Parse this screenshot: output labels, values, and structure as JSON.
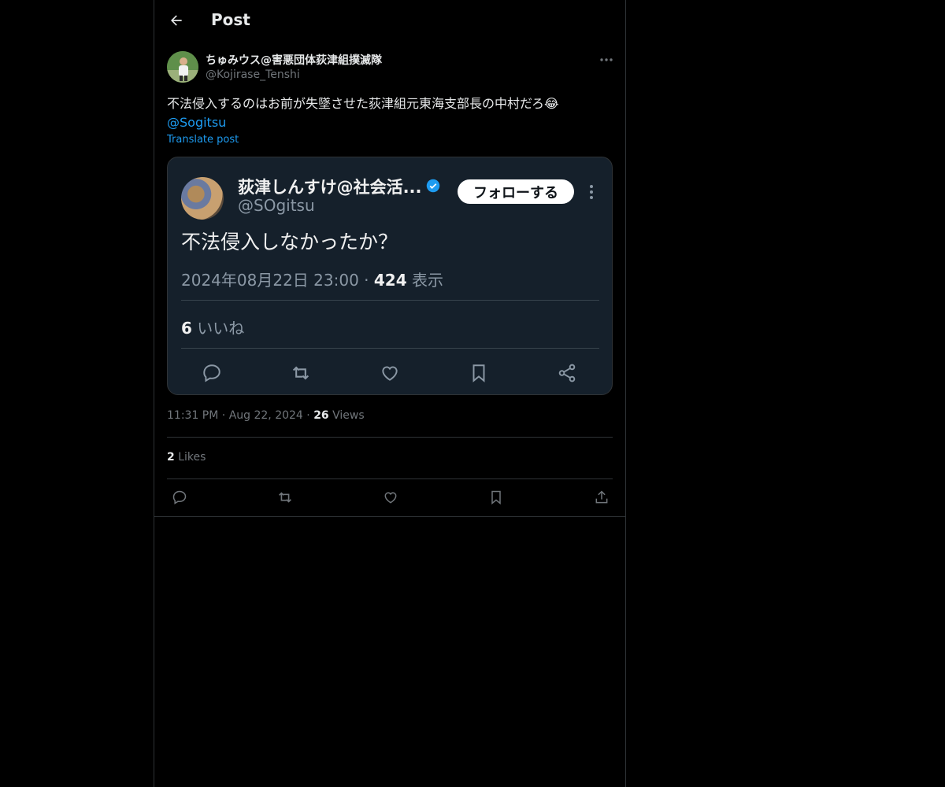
{
  "header": {
    "title": "Post"
  },
  "author": {
    "name": "ちゅみウス@害悪団体荻津組撲滅隊",
    "handle": "@Kojirase_Tenshi"
  },
  "post": {
    "text": "不法侵入するのはお前が失墜させた荻津組元東海支部長の中村だろ😂",
    "mention": "@Sogitsu",
    "translate_label": "Translate post",
    "time": "11:31 PM",
    "date": "Aug 22, 2024",
    "views_count": "26",
    "views_label": "Views",
    "likes_count": "2",
    "likes_label": "Likes"
  },
  "embedded": {
    "name": "荻津しんすけ@社会活...",
    "handle": "@SOgitsu",
    "follow_label": "フォローする",
    "text": "不法侵入しなかったか？",
    "timestamp": "2024年08月22日 23:00 · ",
    "views_count": "424",
    "views_label": "表示",
    "likes_count": "6",
    "likes_label": "いいね"
  },
  "colors": {
    "accent": "#1d9bf0",
    "background": "#000000",
    "embed_background": "#15202b"
  }
}
